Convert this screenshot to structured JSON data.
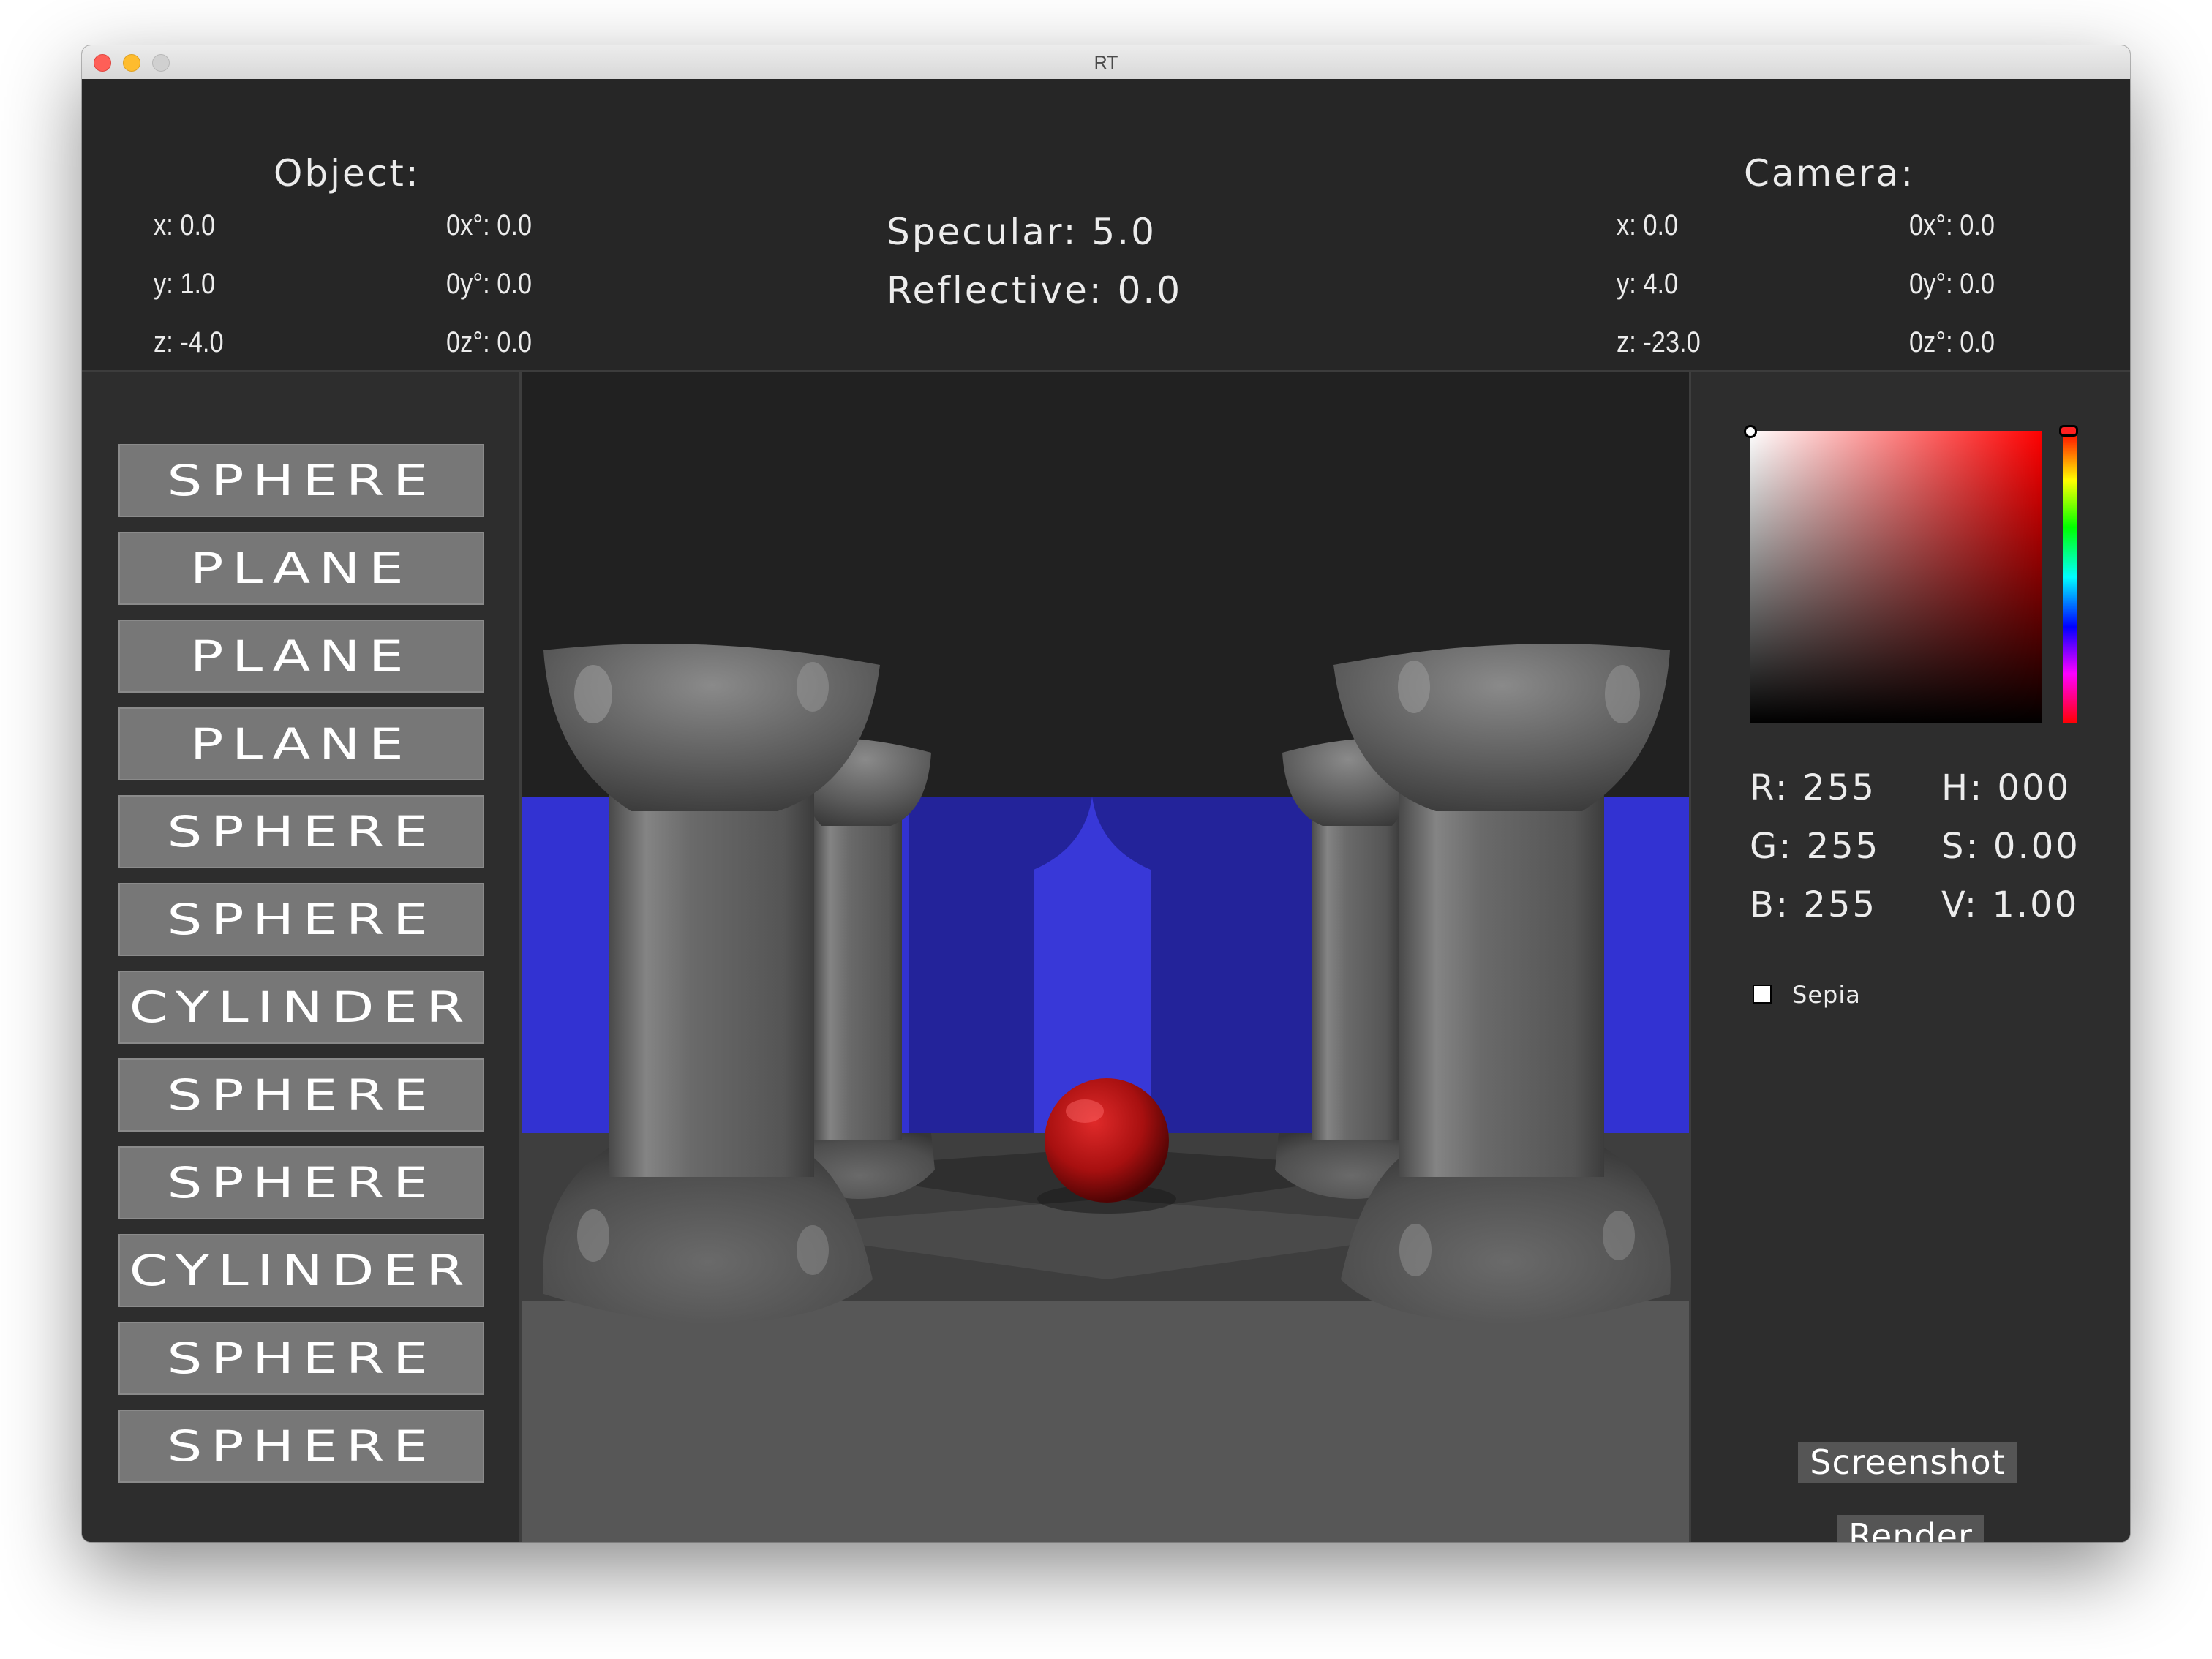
{
  "window": {
    "title": "RT",
    "controls": [
      "close",
      "minimize",
      "maximize"
    ]
  },
  "object_info": {
    "heading": "Object:",
    "x": "x: 0.0",
    "y": "y: 1.0",
    "z": "z: -4.0",
    "rx": "0x°: 0.0",
    "ry": "0y°: 0.0",
    "rz": "0z°: 0.0"
  },
  "material": {
    "specular": "Specular: 5.0",
    "reflective": "Reflective: 0.0"
  },
  "camera_info": {
    "heading": "Camera:",
    "x": "x: 0.0",
    "y": "y: 4.0",
    "z": "z: -23.0",
    "rx": "0x°: 0.0",
    "ry": "0y°: 0.0",
    "rz": "0z°: 0.0"
  },
  "object_list": [
    {
      "label": "SPHERE"
    },
    {
      "label": "PLANE"
    },
    {
      "label": "PLANE"
    },
    {
      "label": "PLANE"
    },
    {
      "label": "SPHERE"
    },
    {
      "label": "SPHERE"
    },
    {
      "label": "CYLINDER"
    },
    {
      "label": "SPHERE"
    },
    {
      "label": "SPHERE"
    },
    {
      "label": "CYLINDER"
    },
    {
      "label": "SPHERE"
    },
    {
      "label": "SPHERE"
    }
  ],
  "color_picker": {
    "hue_color": "#ff0000",
    "r": "R: 255",
    "g": "G: 255",
    "b": "B: 255",
    "h": "H: 000",
    "s": "S: 0.00",
    "v": "V: 1.00"
  },
  "sepia": {
    "label": "Sepia",
    "checked": false
  },
  "actions": {
    "screenshot": "Screenshot",
    "render": "Render"
  },
  "scene_colors": {
    "wall": "#3232d2",
    "sphere": "#c41212",
    "column": "#6e6e6e",
    "floor": "#545454"
  }
}
